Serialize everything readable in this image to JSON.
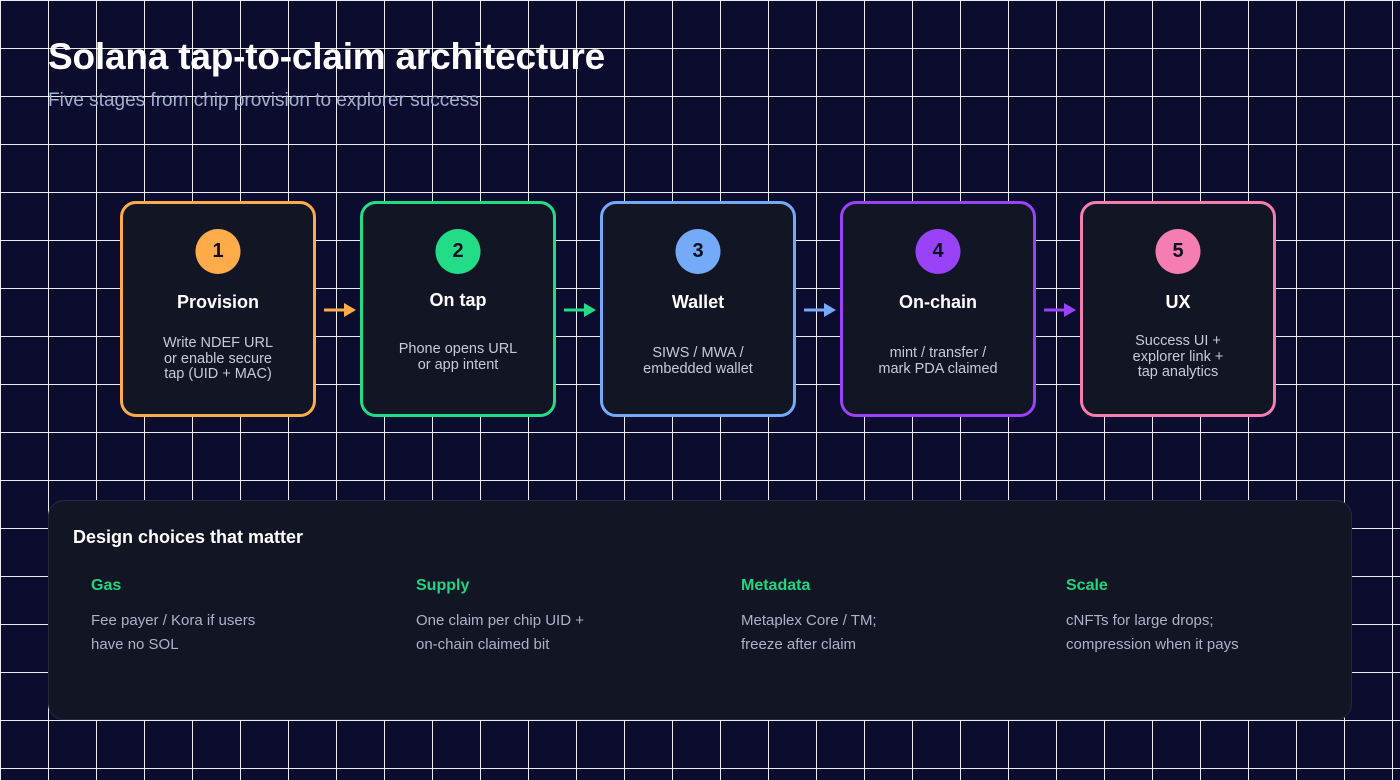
{
  "header": {
    "title": "Solana tap-to-claim architecture",
    "subtitle": "Five stages from chip provision to explorer success"
  },
  "stages": [
    {
      "number": "1",
      "title": "Provision",
      "description": "Write NDEF URL\nor enable secure\ntap (UID + MAC)",
      "color": "#ffab4a"
    },
    {
      "number": "2",
      "title": "On tap",
      "description": "Phone opens URL\nor app intent",
      "color": "#23dc88"
    },
    {
      "number": "3",
      "title": "Wallet",
      "description": "SIWS / MWA /\nembedded wallet",
      "color": "#74aaf8"
    },
    {
      "number": "4",
      "title": "On-chain",
      "description": "mint / transfer /\nmark PDA claimed",
      "color": "#9a42f8"
    },
    {
      "number": "5",
      "title": "UX",
      "description": "Success UI +\nexplorer link +\ntap analytics",
      "color": "#f57daf"
    }
  ],
  "design": {
    "title": "Design choices that matter",
    "choices": [
      {
        "heading": "Gas",
        "text": "Fee payer / Kora if users\nhave no SOL"
      },
      {
        "heading": "Supply",
        "text": "One claim per chip UID +\non-chain claimed bit"
      },
      {
        "heading": "Metadata",
        "text": "Metaplex Core / TM;\nfreeze after claim"
      },
      {
        "heading": "Scale",
        "text": "cNFTs for large drops;\ncompression when it pays"
      }
    ],
    "accent": "#22d37f"
  },
  "colors": {
    "background": "#0b0c2e",
    "grid": "#ffffff",
    "card": "#121624"
  },
  "icons": [
    "arrow-right-icon"
  ]
}
